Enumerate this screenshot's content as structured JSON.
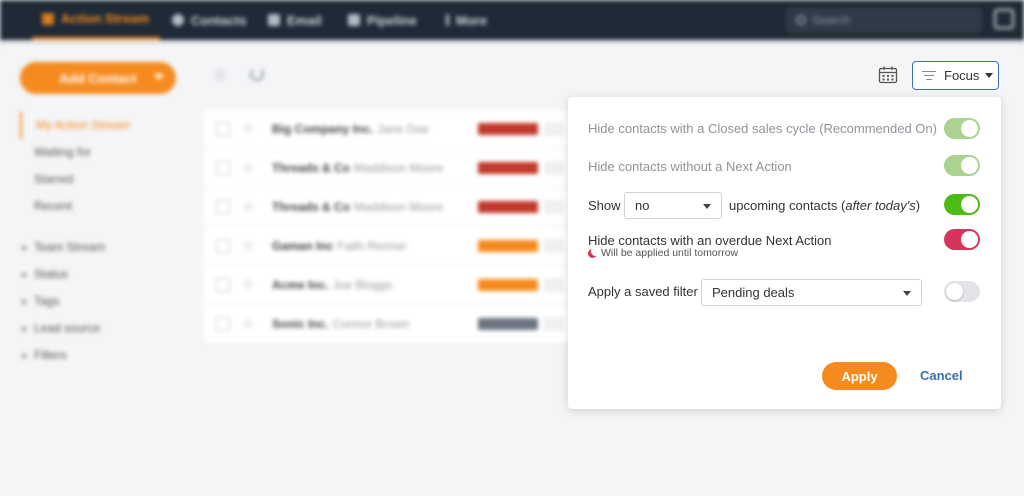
{
  "nav": {
    "items": [
      {
        "label": "Action Stream",
        "icon": "stream-icon"
      },
      {
        "label": "Contacts",
        "icon": "person-icon"
      },
      {
        "label": "Email",
        "icon": "mail-icon"
      },
      {
        "label": "Pipeline",
        "icon": "funnel-icon"
      },
      {
        "label": "More",
        "icon": "more-icon"
      }
    ],
    "search_placeholder": "Search"
  },
  "sidebar": {
    "add_contact_label": "Add Contact",
    "views": [
      "My Action Stream",
      "Waiting for",
      "Starred",
      "Recent"
    ],
    "groups": [
      "Team Stream",
      "Status",
      "Tags",
      "Lead source",
      "Filters"
    ]
  },
  "contacts": [
    {
      "company": "Big Company Inc.",
      "person": "Jane Doe",
      "tag_color": "#c0392b"
    },
    {
      "company": "Threads & Co",
      "person": "Maddison Moore",
      "tag_color": "#c0392b"
    },
    {
      "company": "Threads & Co",
      "person": "Maddison Moore",
      "tag_color": "#c0392b"
    },
    {
      "company": "Gaman Inc",
      "person": "Faith Renner",
      "tag_color": "#f58b1f"
    },
    {
      "company": "Acme Inc.",
      "person": "Joe Bloggs",
      "tag_color": "#f58b1f"
    },
    {
      "company": "Sonic Inc.",
      "person": "Connor Brown",
      "tag_color": "#6b7480"
    }
  ],
  "focus_button": {
    "label": "Focus"
  },
  "focus_panel": {
    "closed_cycle_label": "Hide contacts with a Closed sales cycle (Recommended On)",
    "no_next_action_label": "Hide contacts without a Next Action",
    "show_prefix": "Show",
    "show_select_value": "no",
    "upcoming_label": "upcoming contacts (",
    "upcoming_label_italic": "after today's",
    "upcoming_label_end": ")",
    "overdue_label": "Hide contacts with an overdue Next Action",
    "overdue_note": "Will be applied until tomorrow",
    "saved_filter_label": "Apply a saved filter",
    "saved_filter_value": "Pending deals",
    "apply_label": "Apply",
    "cancel_label": "Cancel"
  },
  "colors": {
    "accent": "#f58b1f",
    "toggle_locked": "#a9d38f",
    "toggle_green": "#4cbb17",
    "toggle_red": "#d6345a",
    "link_blue": "#3b6fb6"
  }
}
